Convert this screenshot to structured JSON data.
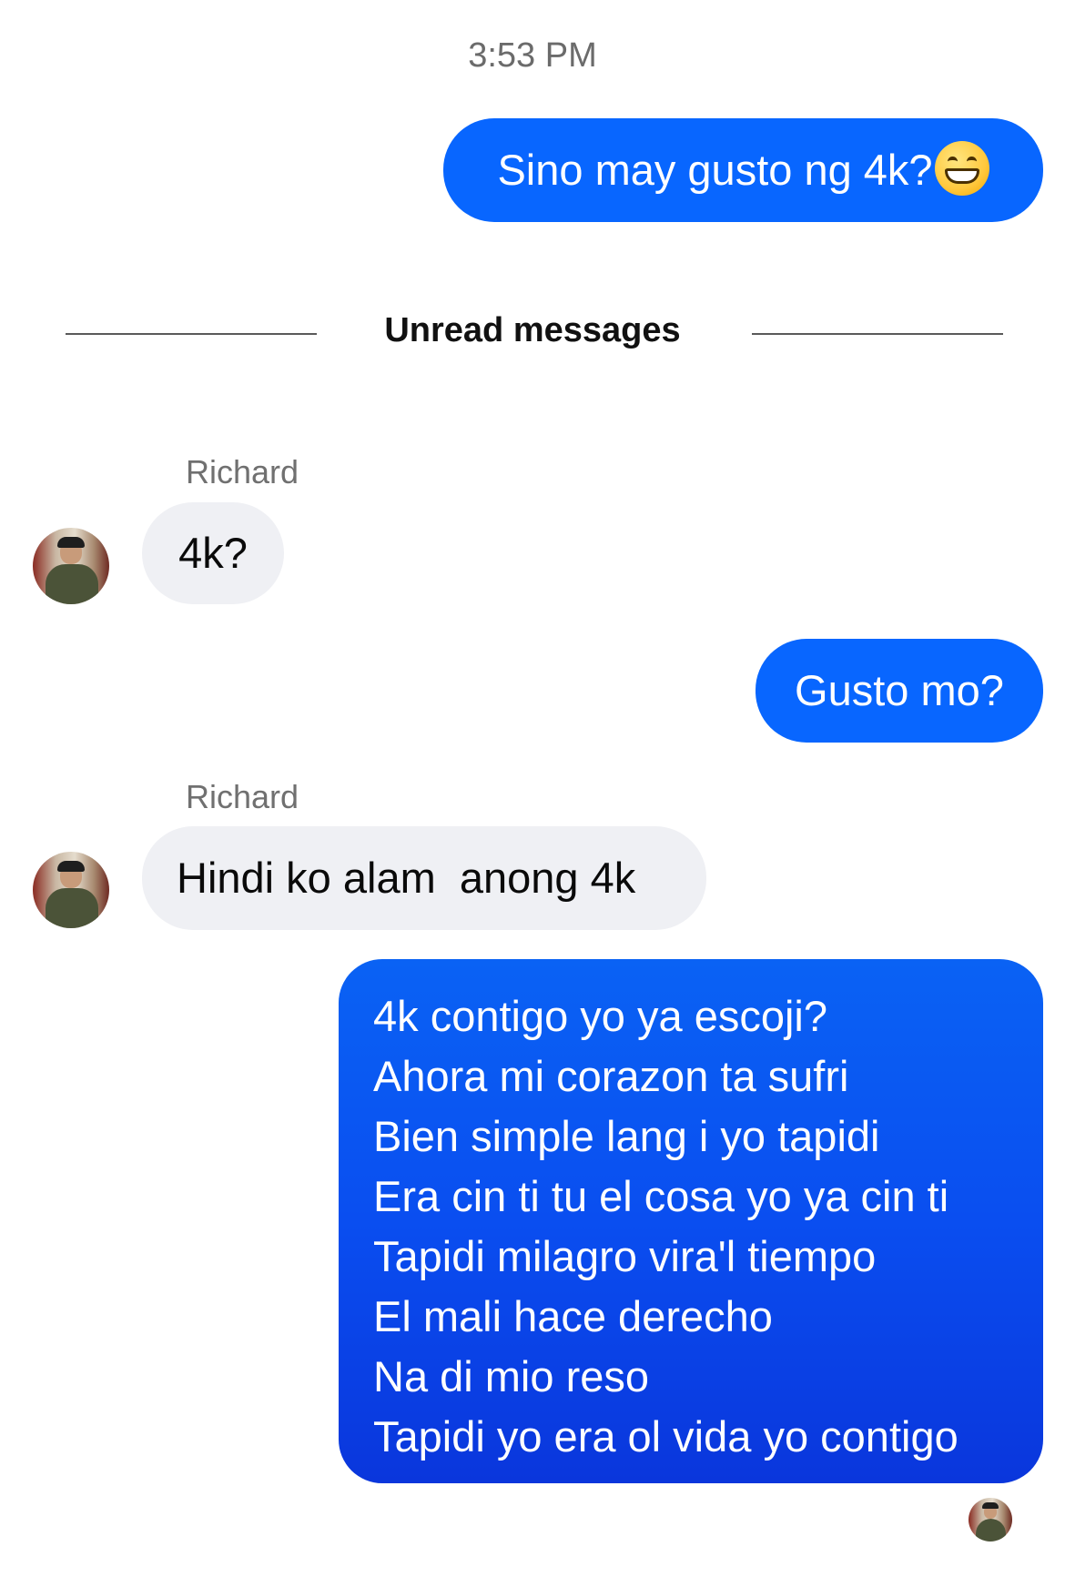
{
  "timestamp": "3:53 PM",
  "divider_label": "Unread messages",
  "messages": [
    {
      "type": "outgoing",
      "text": "Sino may gusto ng 4k?",
      "emoji": "grinning-face-with-smiling-eyes"
    },
    {
      "type": "incoming",
      "sender": "Richard",
      "text": "4k?"
    },
    {
      "type": "outgoing",
      "text": "Gusto mo?"
    },
    {
      "type": "incoming",
      "sender": "Richard",
      "text": "Hindi ko alam  anong 4k"
    },
    {
      "type": "outgoing",
      "lines": [
        "4k contigo yo ya escoji?",
        "Ahora mi corazon ta sufri",
        "Bien simple lang i yo tapidi",
        "Era cin ti tu el cosa yo ya cin ti",
        "Tapidi milagro vira'l tiempo",
        "El mali hace derecho",
        "Na di mio reso",
        "Tapidi yo era ol vida yo contigo"
      ]
    }
  ],
  "colors": {
    "outgoing_bubble": "#0866ff",
    "incoming_bubble": "#eff0f4",
    "gradient_top": "#0a62f4",
    "gradient_bottom": "#0a36dc"
  }
}
